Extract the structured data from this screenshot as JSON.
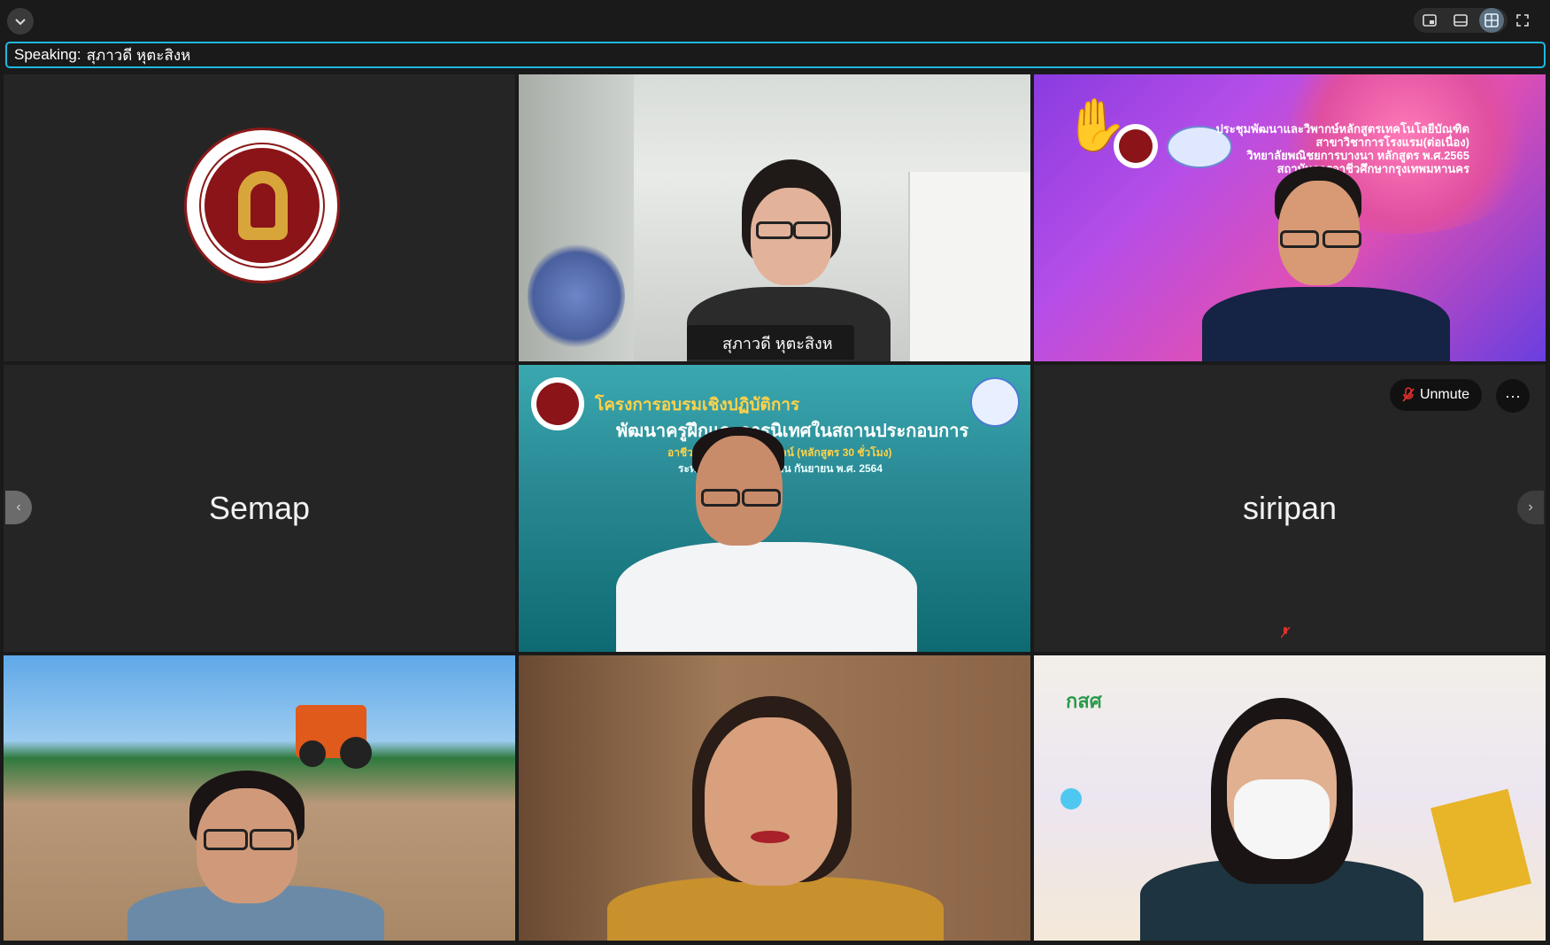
{
  "speaking": {
    "prefix": "Speaking:",
    "name": "สุภาวดี หุตะสิงห"
  },
  "tiles": {
    "t1": {
      "type": "logo"
    },
    "t2": {
      "name": "สุภาวดี หุตะสิงห",
      "active": true
    },
    "t3": {
      "hand_raised": true,
      "background_lines": [
        "ประชุมพัฒนาและวิพากษ์หลักสูตรเทคโนโลยีบัณฑิต",
        "สาขาวิชาการโรงแรม(ต่อเนื่อง)",
        "วิทยาลัยพณิชยการบางนา หลักสูตร พ.ศ.2565",
        "สถาบันการอาชีวศึกษากรุงเทพมหานคร"
      ]
    },
    "t4": {
      "name": "Semap"
    },
    "t5": {
      "background_lines": [
        "โครงการอบรมเชิงปฏิบัติการ",
        "พัฒนาครูฝึกและการนิเทศในสถานประกอบการ",
        "อาชีวศึกษา รูปแบบออนไลน์ (หลักสูตร 30 ชั่วโมง)",
        "ระหว่างวันที่ 12-13 เดือน กันยายน พ.ศ. 2564"
      ]
    },
    "t6": {
      "name": "siripan",
      "unmute_label": "Unmute",
      "more_label": "···"
    },
    "t7": {},
    "t8": {},
    "t9": {
      "logo_text": "กสศ"
    }
  },
  "icons": {
    "collapse": "chevron-down-icon",
    "view_pip": "picture-in-picture-icon",
    "view_filmstrip": "filmstrip-icon",
    "view_grid": "grid-icon",
    "fullscreen": "expand-icon",
    "prev": "chevron-left-icon",
    "next": "chevron-right-icon"
  },
  "colors": {
    "accent": "#1fc3e8",
    "muted": "#e0302b"
  }
}
